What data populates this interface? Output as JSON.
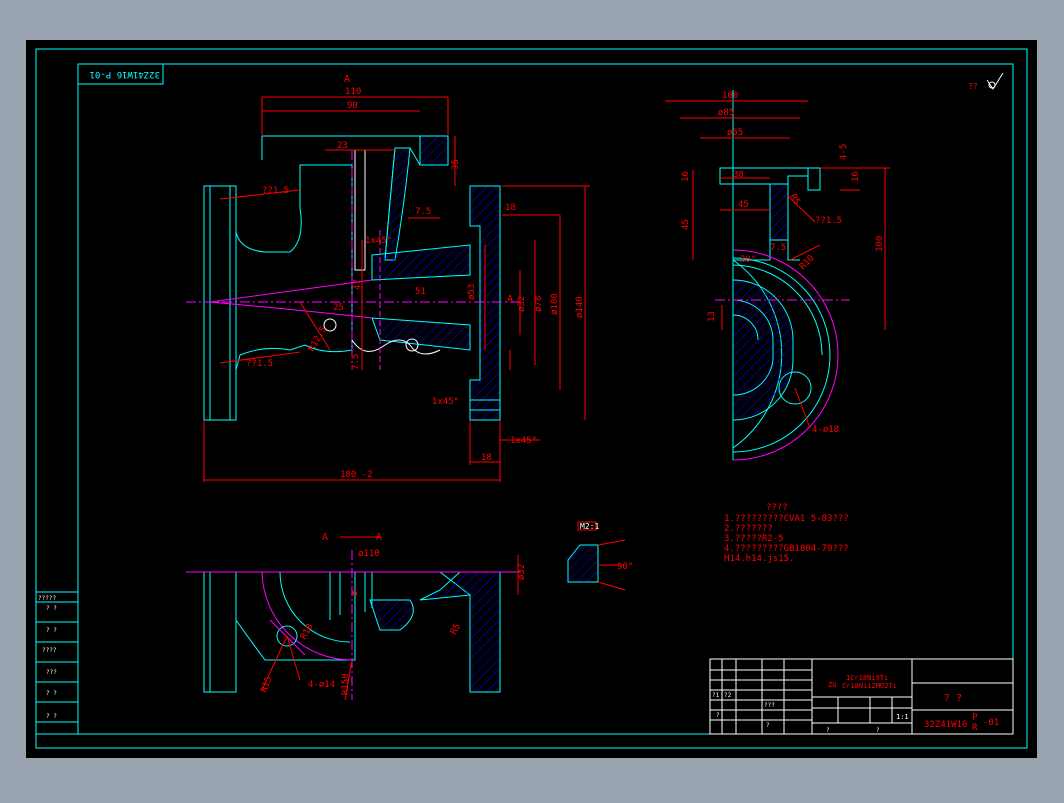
{
  "colors": {
    "window_bg": "#9aa3b0",
    "canvas": "#000000",
    "frame": "#00ffff",
    "dimension": "#ff0000",
    "hatch": "#0000ff",
    "centerline": "#ff00ff",
    "outline_white": "#ffffff"
  },
  "title_block": {
    "drawing_no_rotated": "32Z41W16 P-01",
    "question_marks": "?   ?",
    "drawing_no": "32Z41W16",
    "p_label": "P",
    "r_label": "R",
    "sheet_suffix": "-01",
    "material_line1": "1Cr18Ni9Ti",
    "material_prefix": "ZG",
    "material_line2": "Cr18Ni12MO2Ti",
    "scale": "1:1",
    "cell_marks": [
      "?1",
      "?2",
      "???",
      "?",
      "?",
      "?",
      "?"
    ]
  },
  "roughness_note": "??",
  "notes": {
    "heading": "????",
    "items": [
      "1.?????????CVA1 5-83???",
      "2.???????",
      "3.?????R2-5",
      "4.?????????GB1804-79???",
      "   H14.h14.js15."
    ]
  },
  "detail_label": "M2:1",
  "detail_angle": "90°",
  "section_label_top": "A",
  "section_label_side": "A",
  "section_label_A1": "A",
  "section_label_A2": "A",
  "dims_main": {
    "d110": "110",
    "d90": "90",
    "d23": "23",
    "d35": "35",
    "d7_5a": "7.5",
    "d18": "18",
    "d1x45": "1x45°",
    "r12_5": "R12.5",
    "phi53": "ø53",
    "phi32": "ø32",
    "phi78": "ø78",
    "phi100": "ø100",
    "phi140": "ø140",
    "d180": "180 -2",
    "d18b": "18",
    "d47": "47",
    "d51": "51",
    "d25": "25",
    "d7_5b": "7.5",
    "label_21_5": "??1.5",
    "label_71_5": "??1.5",
    "d1x45b": "1x45°",
    "d1x45c": "1x45°"
  },
  "dims_side": {
    "d100": "100",
    "phi85": "ø85",
    "phi65": "ø65",
    "d38": "38",
    "d16": "16",
    "d16b": "16",
    "d45": "45",
    "d45b": "45",
    "d100v": "100",
    "d7_5": "7.5",
    "d30": "30°",
    "r10": "R10",
    "r5": "R5",
    "d13": "13",
    "phi18": "4-ø18",
    "label_21_5": "??1.5",
    "d4_5": "4-5"
  },
  "dims_bottom": {
    "phi110": "ø110",
    "phi32": "ø32",
    "r15": "R15",
    "phi14": "4-ø14",
    "r150": "R150",
    "r5": "R5",
    "r18": "R18",
    "d6": "6"
  },
  "left_table": {
    "rows": [
      "?????",
      "?  ?",
      "?  ?",
      "????",
      "???",
      "?  ?",
      "?  ?"
    ]
  }
}
